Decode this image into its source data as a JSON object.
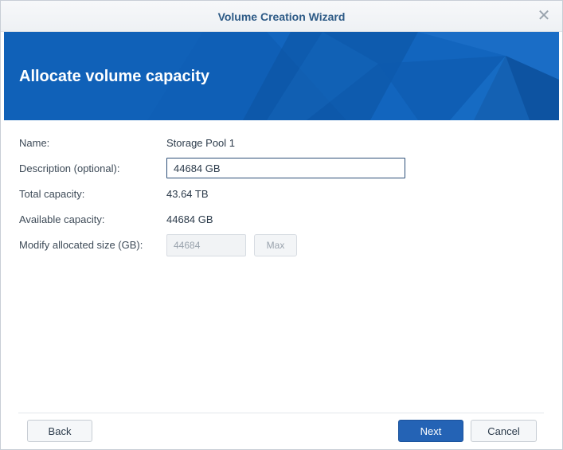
{
  "window": {
    "title": "Volume Creation Wizard",
    "close_icon": "close-icon"
  },
  "banner": {
    "heading": "Allocate volume capacity",
    "background_color": "#0f5fb6"
  },
  "form": {
    "name_label": "Name:",
    "name_value": "Storage Pool 1",
    "description_label": "Description (optional):",
    "description_value": "44684 GB",
    "total_capacity_label": "Total capacity:",
    "total_capacity_value": "43.64 TB",
    "available_capacity_label": "Available capacity:",
    "available_capacity_value": "44684 GB",
    "allocated_size_label": "Modify allocated size (GB):",
    "allocated_size_value": "44684",
    "max_label": "Max"
  },
  "footer": {
    "back_label": "Back",
    "next_label": "Next",
    "cancel_label": "Cancel"
  },
  "colors": {
    "accent": "#2463b5",
    "title_text": "#2d5a86"
  }
}
